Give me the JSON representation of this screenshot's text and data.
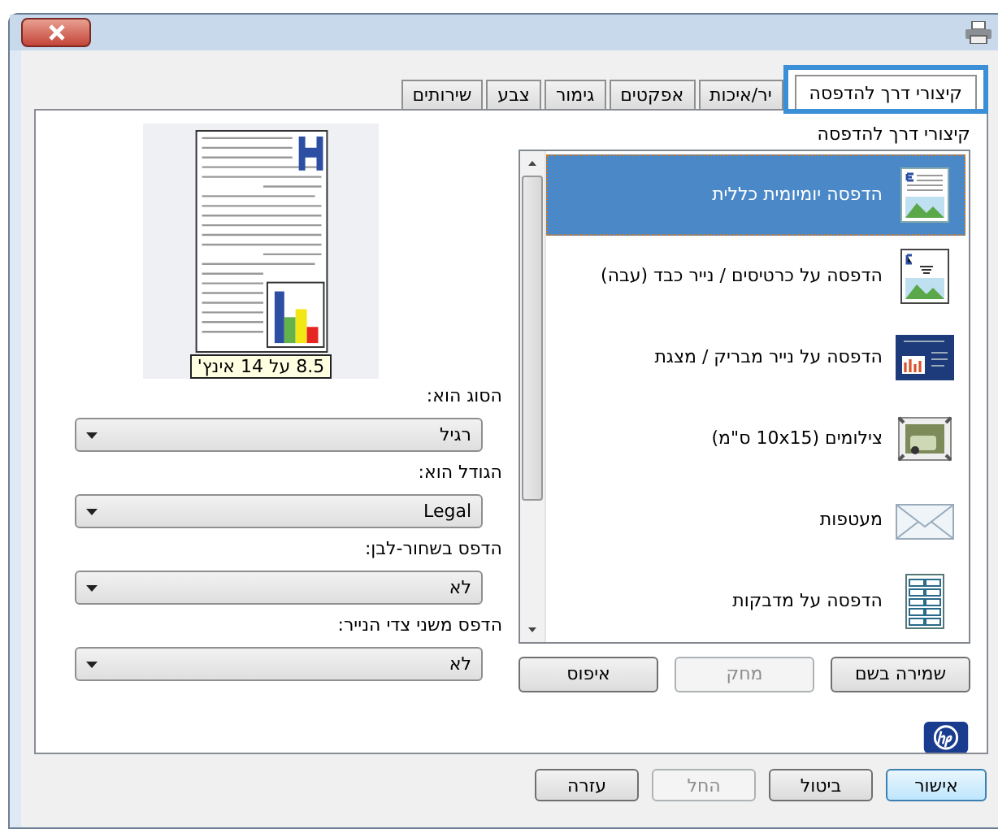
{
  "tabs": [
    {
      "label": "קיצורי דרך להדפסה",
      "selected": true,
      "highlighted": true
    },
    {
      "label": "יר/איכות",
      "selected": false,
      "highlighted": false
    },
    {
      "label": "אפקטים",
      "selected": false,
      "highlighted": false
    },
    {
      "label": "גימור",
      "selected": false,
      "highlighted": false
    },
    {
      "label": "צבע",
      "selected": false,
      "highlighted": false
    },
    {
      "label": "שירותים",
      "selected": false,
      "highlighted": false
    }
  ],
  "shortcuts": {
    "heading": "קיצורי דרך להדפסה",
    "items": [
      {
        "label": "הדפסה יומיומית כללית",
        "kind": "document",
        "selected": true
      },
      {
        "label": "הדפסה על כרטיסים / נייר כבד (עבה)",
        "kind": "cardstock",
        "selected": false
      },
      {
        "label": "הדפסה על נייר מבריק / מצגת",
        "kind": "presentation",
        "selected": false
      },
      {
        "label": "צילומים (10x15 ס\"מ)",
        "kind": "photo",
        "selected": false
      },
      {
        "label": "מעטפות",
        "kind": "envelope",
        "selected": false
      },
      {
        "label": "הדפסה על מדבקות",
        "kind": "labels",
        "selected": false
      }
    ],
    "buttons": [
      {
        "label": "שמירה בשם",
        "disabled": false
      },
      {
        "label": "מחק",
        "disabled": true
      },
      {
        "label": "איפוס",
        "disabled": false
      }
    ]
  },
  "preview": {
    "caption": "8.5 על 14 אינץ'"
  },
  "settings": [
    {
      "label": "הסוג הוא:",
      "value": "רגיל"
    },
    {
      "label": "הגודל הוא:",
      "value": "Legal"
    },
    {
      "label": "הדפס בשחור-לבן:",
      "value": "לא"
    },
    {
      "label": "הדפס משני צדי הנייר:",
      "value": "לא"
    }
  ],
  "dialog_buttons": [
    {
      "label": "אישור",
      "disabled": false,
      "default": true
    },
    {
      "label": "ביטול",
      "disabled": false,
      "default": false
    },
    {
      "label": "החל",
      "disabled": true,
      "default": false
    },
    {
      "label": "עזרה",
      "disabled": false,
      "default": false
    }
  ]
}
